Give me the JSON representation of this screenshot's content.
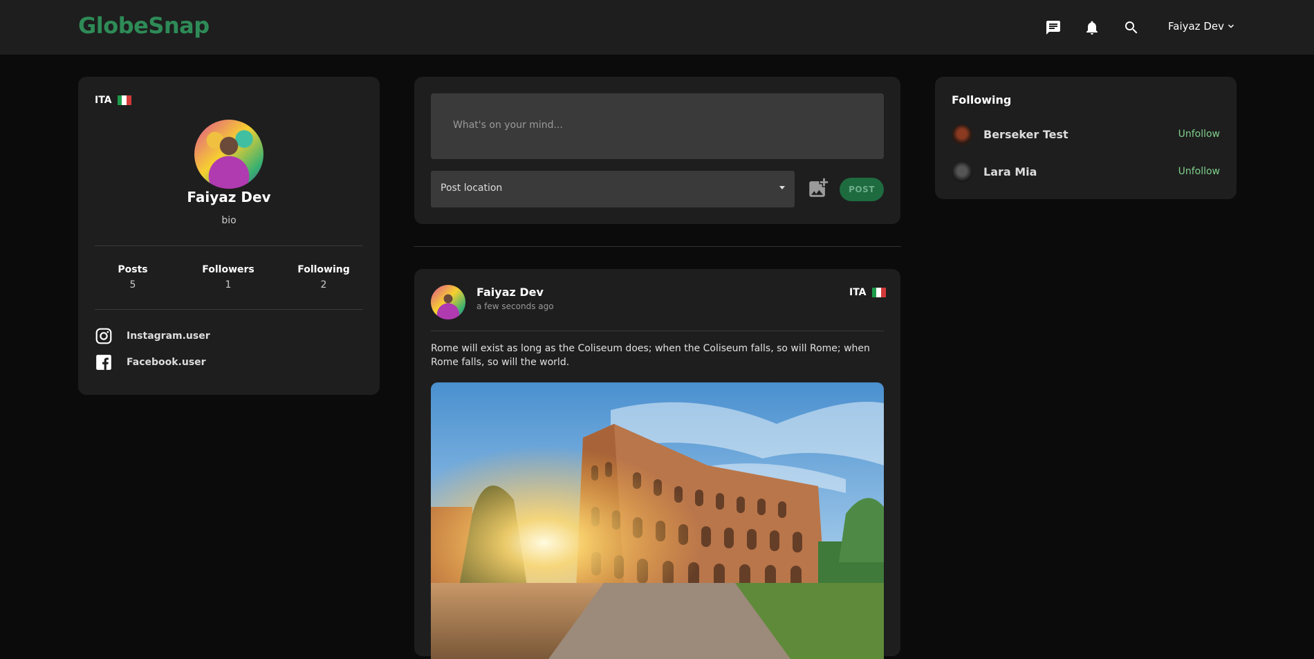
{
  "app": {
    "name": "GlobeSnap",
    "brand_color": "#2e8b57"
  },
  "header": {
    "icons": [
      "chat-icon",
      "bell-icon",
      "search-icon"
    ],
    "user_menu_label": "Faiyaz Dev"
  },
  "profile": {
    "country": "ITA",
    "name": "Faiyaz Dev",
    "bio": "bio",
    "stats": [
      {
        "label": "Posts",
        "value": "5"
      },
      {
        "label": "Followers",
        "value": "1"
      },
      {
        "label": "Following",
        "value": "2"
      }
    ],
    "socials": [
      {
        "icon": "instagram-icon",
        "label": "Instagram.user"
      },
      {
        "icon": "facebook-icon",
        "label": "Facebook.user"
      }
    ]
  },
  "composer": {
    "placeholder": "What's on your mind...",
    "location_placeholder": "Post location",
    "post_label": "POST"
  },
  "post": {
    "author": "Faiyaz Dev",
    "time": "a few seconds ago",
    "country": "ITA",
    "text": "Rome will exist as long as the Coliseum does; when the Coliseum falls, so will Rome; when Rome falls, so will the world."
  },
  "following": {
    "title": "Following",
    "users": [
      {
        "name": "Berseker Test",
        "action": "Unfollow"
      },
      {
        "name": "Lara Mia",
        "action": "Unfollow"
      }
    ]
  }
}
